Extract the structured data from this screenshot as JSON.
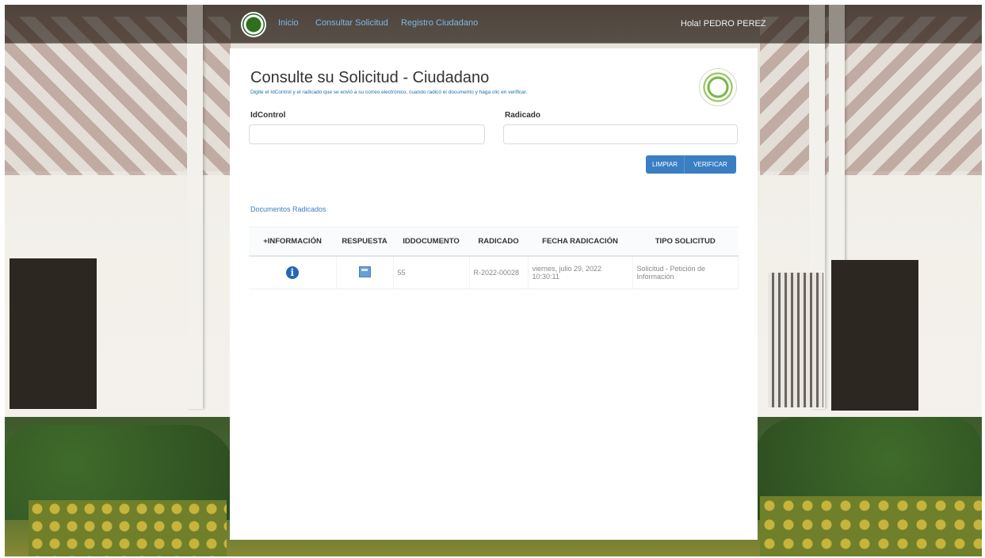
{
  "navbar": {
    "links": [
      "Inicio",
      "Consultar Solicitud",
      "Registro Ciudadano"
    ],
    "user_greeting": "Hola! PEDRO PEREZ"
  },
  "page": {
    "title": "Consulte su Solicitud - Ciudadano",
    "subtitle": "Digite el IdControl y el radicado que se envió a su correo electrónico, cuando radicó el documento y haga clic en verificar."
  },
  "form": {
    "idcontrol_label": "IdControl",
    "idcontrol_value": "",
    "radicado_label": "Radicado",
    "radicado_value": "",
    "limpiar_label": "LIMPIAR",
    "verificar_label": "VERIFICAR"
  },
  "documents": {
    "section_title": "Documentos Radicados",
    "columns": [
      "+INFORMACIÓN",
      "RESPUESTA",
      "IDDOCUMENTO",
      "RADICADO",
      "FECHA RADICACIÓN",
      "TIPO SOLICITUD"
    ],
    "rows": [
      {
        "info_icon": "info-icon",
        "response_icon": "document-icon",
        "iddocumento": "55",
        "radicado": "R-2022-00028",
        "fecha": "viernes, julio 29, 2022 10:30:11",
        "tipo": "Solicitud - Petición de Información"
      }
    ]
  },
  "colors": {
    "accent": "#3a7fc4",
    "info_icon": "#2466b8",
    "navbar_link": "#7fb8e8"
  }
}
